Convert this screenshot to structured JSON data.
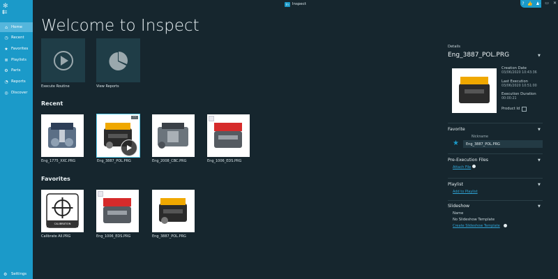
{
  "window": {
    "title": "Inspect",
    "badge": "In"
  },
  "sidebar": {
    "items": [
      {
        "label": "Home",
        "icon": "home-icon"
      },
      {
        "label": "Recent",
        "icon": "clock-icon"
      },
      {
        "label": "Favorites",
        "icon": "star-icon"
      },
      {
        "label": "Playlists",
        "icon": "playlist-icon"
      },
      {
        "label": "Parts",
        "icon": "parts-icon"
      },
      {
        "label": "Reports",
        "icon": "reports-icon"
      },
      {
        "label": "Discover",
        "icon": "discover-icon"
      }
    ],
    "settings": "Settings"
  },
  "main": {
    "title": "Welcome to Inspect",
    "quick_actions": [
      {
        "label": "Execute Routine"
      },
      {
        "label": "View Reports"
      }
    ],
    "recent_title": "Recent",
    "recent": [
      {
        "name": "Eng_1775_XXC.PRG"
      },
      {
        "name": "Eng_3887_POL.PRG"
      },
      {
        "name": "Eng_2008_CBC.PRG"
      },
      {
        "name": "Eng_1006_EDS.PRG"
      }
    ],
    "favorites_title": "Favorites",
    "favorites": [
      {
        "name": "Calibrate All.PRG",
        "caption": "CALIBRATION"
      },
      {
        "name": "Eng_1006_EDS.PRG"
      },
      {
        "name": "Eng_3887_POL.PRG"
      }
    ]
  },
  "details": {
    "header": "Details",
    "file": "Eng_3887_POL.PRG",
    "creation_date_label": "Creation Date",
    "creation_date": "03/06/2020 10:43:36",
    "last_execution_label": "Last Execution",
    "last_execution": "03/06/2020 10:51:00",
    "execution_duration_label": "Execution Duration",
    "execution_duration": "00:00:21",
    "product_id_label": "Product Id",
    "favorite_title": "Favorite",
    "nickname_label": "Nickname",
    "nickname_value": "Eng_3887_POL.PRG",
    "pre_exec_title": "Pre-Execution Files",
    "attach_file": "Attach File",
    "playlist_title": "Playlist",
    "add_to_playlist": "Add to Playlist",
    "slideshow_title": "Slideshow",
    "slideshow_name_label": "Name",
    "slideshow_name_value": "No Slideshow Template",
    "create_slideshow": "Create Slideshow Template"
  },
  "colors": {
    "sidebar": "#1b9ac9",
    "background": "#16262e",
    "tile": "#1f3d47",
    "link": "#2fa4d6",
    "accent": "#5ad0f0"
  }
}
